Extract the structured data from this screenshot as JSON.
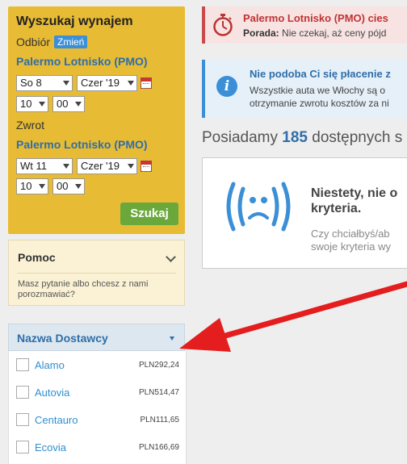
{
  "search": {
    "title": "Wyszukaj wynajem",
    "pickup_label": "Odbiór",
    "change_label": "Zmień",
    "pickup_location": "Palermo Lotnisko (PMO)",
    "pickup_day": "So 8",
    "pickup_month": "Czer '19",
    "pickup_hour": "10",
    "pickup_minute": "00",
    "return_label": "Zwrot",
    "return_location": "Palermo Lotnisko (PMO)",
    "return_day": "Wt 11",
    "return_month": "Czer '19",
    "return_hour": "10",
    "return_minute": "00",
    "search_button": "Szukaj"
  },
  "help": {
    "title": "Pomoc",
    "text": "Masz pytanie albo chcesz z nami porozmawiać?"
  },
  "filter": {
    "title": "Nazwa Dostawcy",
    "vendors": [
      {
        "name": "Alamo",
        "price": "PLN292,24"
      },
      {
        "name": "Autovia",
        "price": "PLN514,47"
      },
      {
        "name": "Centauro",
        "price": "PLN111,65"
      },
      {
        "name": "Ecovia",
        "price": "PLN166,69"
      }
    ]
  },
  "alert_red": {
    "title": "Palermo Lotnisko (PMO) cies",
    "tip_label": "Porada:",
    "tip_text": "Nie czekaj, aż ceny pójd"
  },
  "alert_blue": {
    "title": "Nie podoba Ci się płacenie z",
    "line1": "Wszystkie auta we Włochy są o",
    "line2": "otrzymanie zwrotu kosztów za ni"
  },
  "availability": {
    "prefix": "Posiadamy",
    "count": "185",
    "suffix": "dostępnych s"
  },
  "empty": {
    "line1": "Niestety, nie o",
    "line2": "kryteria.",
    "line3": "Czy chciałbyś/ab",
    "line4": "swoje kryteria wy"
  },
  "colors": {
    "search_bg": "#e8bb34",
    "accent_blue": "#2f6ea8",
    "button_green": "#6aa83c",
    "alert_red": "#c84a4a",
    "arrow_red": "#e41e1e"
  }
}
